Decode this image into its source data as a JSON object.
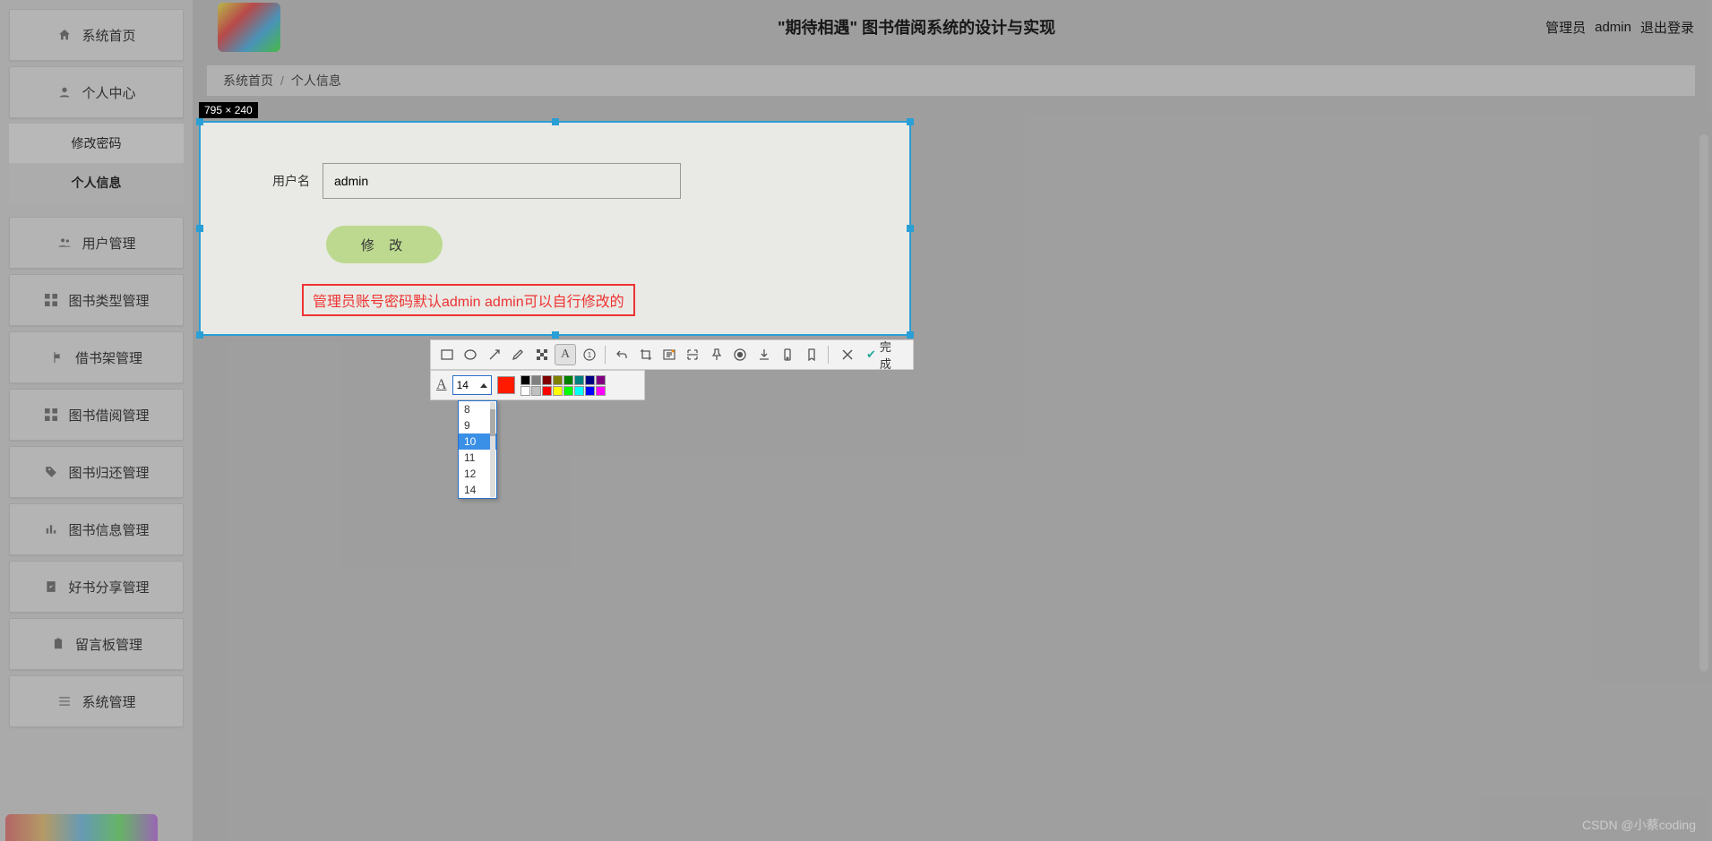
{
  "header": {
    "title": "\"期待相遇\" 图书借阅系统的设计与实现",
    "role_prefix": "管理员",
    "username": "admin",
    "logout": "退出登录"
  },
  "sidebar": {
    "home": "系统首页",
    "personal": "个人中心",
    "sub_pwd": "修改密码",
    "sub_info": "个人信息",
    "items": [
      "用户管理",
      "图书类型管理",
      "借书架管理",
      "图书借阅管理",
      "图书归还管理",
      "图书信息管理",
      "好书分享管理",
      "留言板管理",
      "系统管理"
    ]
  },
  "breadcrumb": {
    "home": "系统首页",
    "current": "个人信息"
  },
  "form": {
    "username_label": "用户名",
    "username_value": "admin",
    "save_btn": "修 改",
    "note": "管理员账号密码默认admin admin可以自行修改的"
  },
  "capture": {
    "dim_label": "795 × 240",
    "done_label": "完成",
    "font_size_current": "14",
    "font_size_options": [
      "8",
      "9",
      "10",
      "11",
      "12",
      "14"
    ],
    "font_size_selected": "10",
    "palette_row1": [
      "#000000",
      "#808080",
      "#800000",
      "#808000",
      "#008000",
      "#008080",
      "#000080",
      "#800080"
    ],
    "palette_row2": [
      "#ffffff",
      "#c0c0c0",
      "#ff0000",
      "#ffff00",
      "#00ff00",
      "#00ffff",
      "#0000ff",
      "#ff00ff"
    ]
  },
  "watermark": "CSDN @小蔡coding"
}
